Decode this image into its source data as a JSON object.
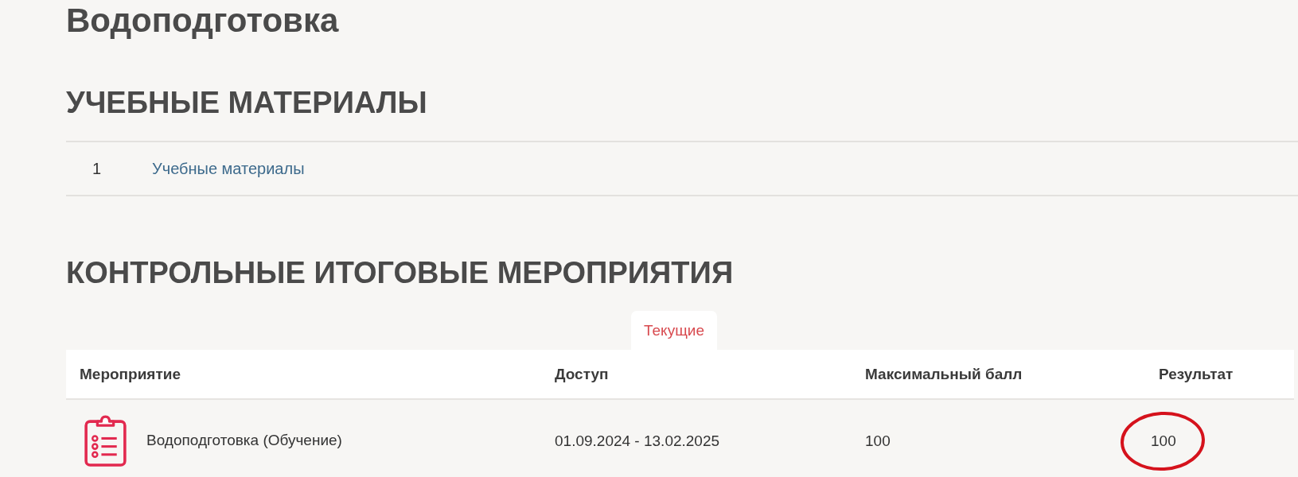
{
  "page": {
    "title": "Водоподготовка"
  },
  "materials": {
    "heading": "УЧЕБНЫЕ МАТЕРИАЛЫ",
    "items": [
      {
        "number": "1",
        "title": "Учебные материалы"
      }
    ]
  },
  "final_events": {
    "heading": "КОНТРОЛЬНЫЕ ИТОГОВЫЕ МЕРОПРИЯТИЯ",
    "tabs": [
      {
        "label": "Текущие",
        "selected": true
      }
    ],
    "table": {
      "columns": [
        "Мероприятие",
        "Доступ",
        "Максимальный балл",
        "Результат"
      ],
      "rows": [
        {
          "event": "Водоподготовка (Обучение)",
          "access": "01.09.2024 - 13.02.2025",
          "max_score": "100",
          "result": "100",
          "result_circled": true
        }
      ]
    }
  }
}
